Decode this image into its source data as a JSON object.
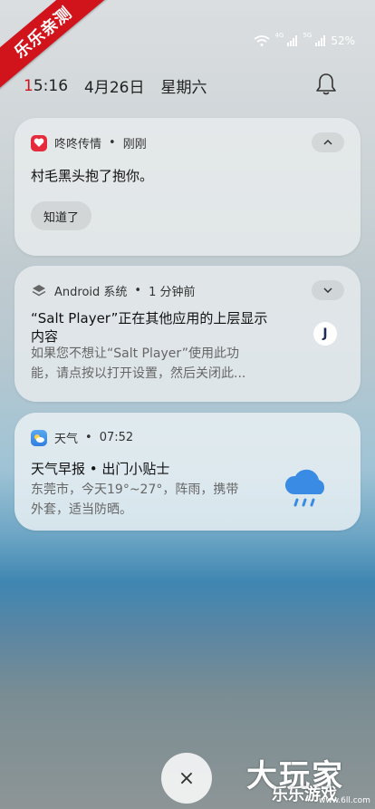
{
  "watermark_ribbon": "乐乐亲测",
  "status_bar": {
    "signal_1_label": "4G",
    "signal_2_label": "5G",
    "battery": "52%",
    "time_first_digit": "1",
    "time_rest": "5:16",
    "date": "4月26日",
    "weekday": "星期六"
  },
  "notifications": [
    {
      "app": "咚咚传情",
      "time": "刚刚",
      "title": "村毛黑头抱了抱你。",
      "action": "知道了"
    },
    {
      "app": "Android 系统",
      "time": "1 分钟前",
      "title_line1": "“Salt Player”正在其他应用的上层显示",
      "title_line2": "内容",
      "body_line1": "如果您不想让“Salt Player”使用此功",
      "body_line2": "能，请点按以打开设置，然后关闭此...",
      "badge": "J"
    },
    {
      "app": "天气",
      "time": "07:52",
      "title": "天气早报 • 出门小贴士",
      "body_line1": "东莞市，今天19°~27°，阵雨，携带",
      "body_line2": "外套，适当防晒。"
    }
  ],
  "close_button": "×",
  "bottom_watermark": {
    "line1": "大玩家",
    "line2": "乐乐游戏",
    "url": "www.6ll.com"
  },
  "separator": "•",
  "icons": {
    "wifi": "wifi-icon",
    "bell": "bell-icon",
    "collapse": "chevron-up-icon",
    "expand": "chevron-down-icon",
    "android_system": "layers-icon",
    "heart_app": "heart-icon",
    "weather_app": "cloud-sun-icon",
    "rain": "rain-cloud-icon"
  },
  "colors": {
    "accent_red": "#d1141b",
    "heart_app": "#e52a3b",
    "weather_app": "#2f7fe0",
    "rain_icon": "#3a8be3"
  }
}
